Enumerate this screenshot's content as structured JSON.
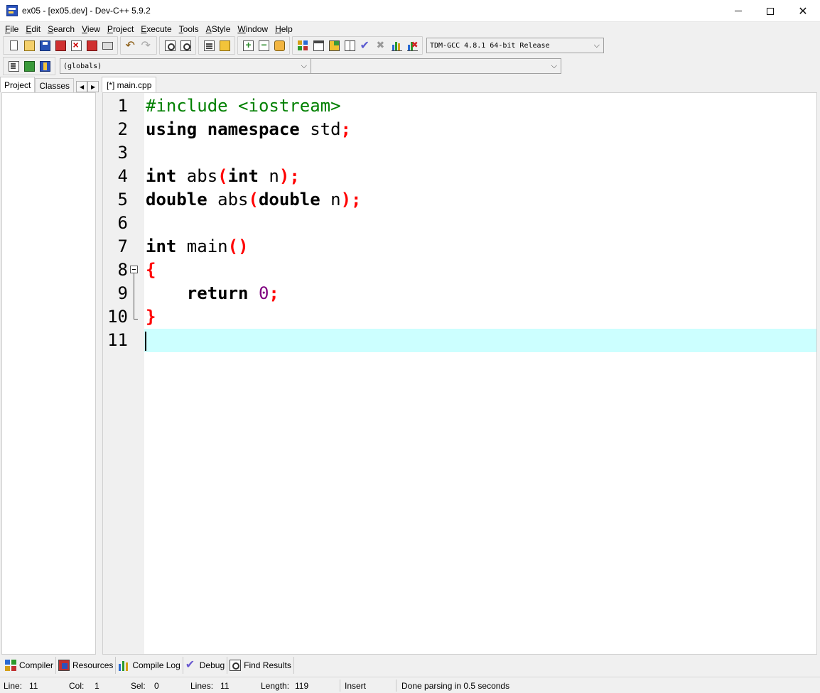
{
  "window": {
    "title": "ex05 - [ex05.dev] - Dev-C++ 5.9.2",
    "minimize": "",
    "maximize": "",
    "close": "✕"
  },
  "menu": [
    {
      "label": "File",
      "ul": "F",
      "rest": "ile"
    },
    {
      "label": "Edit",
      "ul": "E",
      "rest": "dit"
    },
    {
      "label": "Search",
      "ul": "S",
      "rest": "earch"
    },
    {
      "label": "View",
      "ul": "V",
      "rest": "iew"
    },
    {
      "label": "Project",
      "ul": "P",
      "rest": "roject"
    },
    {
      "label": "Execute",
      "ul": "E",
      "rest": "xecute"
    },
    {
      "label": "Tools",
      "ul": "T",
      "rest": "ools"
    },
    {
      "label": "AStyle",
      "ul": "A",
      "rest": "Style"
    },
    {
      "label": "Window",
      "ul": "W",
      "rest": "indow"
    },
    {
      "label": "Help",
      "ul": "H",
      "rest": "elp"
    }
  ],
  "toolbar": {
    "compiler_select": "TDM-GCC 4.8.1 64-bit Release",
    "globals_select": "(globals)",
    "members_select": ""
  },
  "left_panel": {
    "tabs": [
      "Project",
      "Classes"
    ],
    "scroll_left": "◀",
    "scroll_right": "▶"
  },
  "editor": {
    "tab_label": "[*] main.cpp",
    "line_numbers": [
      "1",
      "2",
      "3",
      "4",
      "5",
      "6",
      "7",
      "8",
      "9",
      "10",
      "11"
    ],
    "current_line": 11
  },
  "bottom_tabs": [
    "Compiler",
    "Resources",
    "Compile Log",
    "Debug",
    "Find Results"
  ],
  "status": {
    "line_label": "Line:",
    "line_value": "11",
    "col_label": "Col:",
    "col_value": "1",
    "sel_label": "Sel:",
    "sel_value": "0",
    "lines_label": "Lines:",
    "lines_value": "11",
    "length_label": "Length:",
    "length_value": "119",
    "mode": "Insert",
    "message": "Done parsing in 0.5 seconds"
  },
  "code": {
    "l1_pre": "#include <iostream>",
    "l2_kw1": "using",
    "l2_kw2": "namespace",
    "l2_id": " std",
    "l4_kw1": "int",
    "l4_id1": " abs",
    "l4_kw2": "int",
    "l4_id2": " n",
    "l5_kw1": "double",
    "l5_id1": " abs",
    "l5_kw2": "double",
    "l5_id2": " n",
    "l7_kw": "int",
    "l7_id": " main",
    "l9_indent": "    ",
    "l9_kw": "return",
    "l9_num": "0",
    "semicolon": ";",
    "lparen": "(",
    "rparen": ")",
    "lbrace": "{",
    "rbrace": "}",
    "space": " "
  },
  "icons": {
    "toolbar_row1": [
      "new-file-icon",
      "open-project-icon",
      "save-icon",
      "save-all-icon",
      "close-file-icon",
      "print-icon",
      "undo-icon",
      "redo-icon",
      "find-icon",
      "replace-icon",
      "indent-icon",
      "unindent-icon",
      "add-to-project-icon",
      "remove-from-project-icon",
      "project-options-icon",
      "compile-icon",
      "run-icon",
      "compile-run-icon",
      "rebuild-icon",
      "syntax-check-icon",
      "stop-icon",
      "profile-icon",
      "delete-profile-icon"
    ],
    "toolbar_row2": [
      "new-class-icon",
      "new-member-icon",
      "insert-icon"
    ]
  },
  "colors": {
    "current_line_bg": "#ccffff",
    "keyword": "#000000",
    "preprocessor": "#008000",
    "symbol": "#ff0000",
    "number": "#800080"
  }
}
